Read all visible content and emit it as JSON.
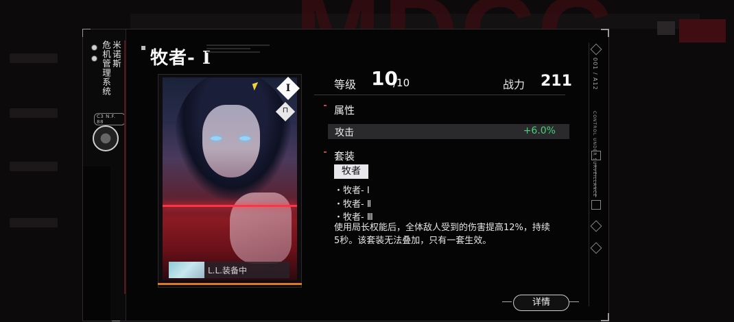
{
  "background": {
    "big_text": "MDCC",
    "accent_color": "#3a0c10"
  },
  "panel": {
    "vertical_title_col1": "米诺斯",
    "vertical_title_col2": "危机管理系统",
    "badge": "C3 N.F. 88",
    "side_tag_1": "CONTROL UNDER SURVEILLANCE",
    "side_tag_2": "001 / A12"
  },
  "item": {
    "name": "牧者- Ⅰ",
    "rank_icon": "Ⅰ",
    "equip_status": "L.L.装备中",
    "rarity_color": "#e07a1a"
  },
  "stats": {
    "level_label": "等级",
    "level_value": "10",
    "level_max": "/10",
    "power_label": "战力",
    "power_value": "211"
  },
  "attributes": {
    "section_title": "属性",
    "rows": [
      {
        "name": "攻击",
        "value": "+6.0%"
      }
    ]
  },
  "set": {
    "section_title": "套装",
    "tag": "牧者",
    "items": [
      "・牧者- Ⅰ",
      "・牧者- Ⅱ",
      "・牧者- Ⅲ"
    ],
    "description": "使用局长权能后，全体敌人受到的伤害提高12%，持续5秒。该套装无法叠加，只有一套生效。"
  },
  "actions": {
    "detail_label": "详情"
  },
  "icons": {
    "rank": "rank-diamond-icon",
    "lock": "lock-icon",
    "cursor": "cursor-icon",
    "emblem": "emblem-icon"
  }
}
